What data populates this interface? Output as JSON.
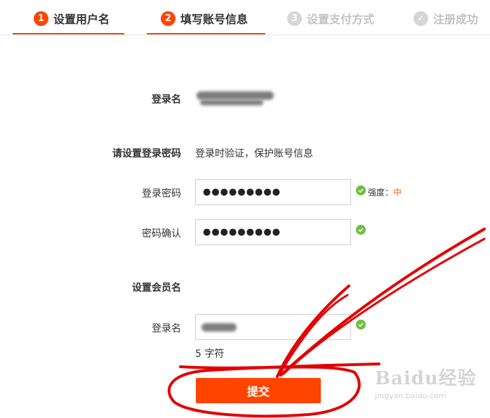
{
  "steps": [
    {
      "number": "1",
      "label": "设置用户名",
      "state": "active"
    },
    {
      "number": "2",
      "label": "填写账号信息",
      "state": "active"
    },
    {
      "number": "3",
      "label": "设置支付方式",
      "state": "inactive"
    },
    {
      "number": "✓",
      "label": "注册成功",
      "state": "inactive"
    }
  ],
  "form": {
    "login_name_label": "登录名",
    "password_section_label": "请设置登录密码",
    "password_section_desc": "登录时验证，保护账号信息",
    "password_label": "登录密码",
    "password_value": "●●●●●●●●●",
    "strength_prefix": "强度：",
    "strength_level": "中",
    "confirm_label": "密码确认",
    "confirm_value": "●●●●●●●●●",
    "member_section_label": "设置会员名",
    "member_name_label": "登录名",
    "char_count": "5 字符",
    "submit_label": "提交"
  },
  "watermark": {
    "brand": "Baidu经验",
    "url": "jingyan.baidu.com"
  },
  "colors": {
    "accent": "#ff4400",
    "success": "#6cbf3f",
    "annotation": "#e30000"
  }
}
